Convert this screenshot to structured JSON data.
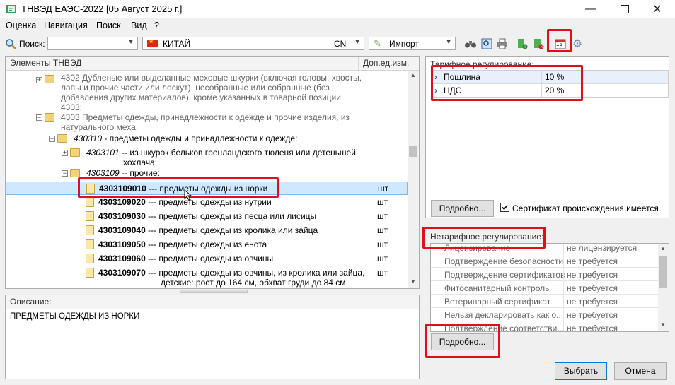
{
  "window": {
    "title": "ТНВЭД ЕАЭС-2022 [05 Август 2025 г.]"
  },
  "menu": [
    "Оценка",
    "Навигация",
    "Поиск",
    "Вид",
    "?"
  ],
  "toolbar": {
    "search_label": "Поиск:",
    "search_value": "",
    "country_name": "КИТАЙ",
    "country_code": "CN",
    "direction": "Импорт",
    "calendar_label": "15"
  },
  "tree": {
    "header": "Элементы ТНВЭД",
    "unit_header": "Доп.ед.изм.",
    "nodes": [
      {
        "lines": [
          "4302 Дубленые или выделанные меховые шкурки (включая головы, хвосты,",
          "лапы и прочие части или лоскут), несобранные или собранные (без",
          "добавления других материалов), кроме указанных в товарной позиции",
          "4303:"
        ]
      },
      {
        "lines": [
          "4303 Предметы одежды, принадлежности к одежде и прочие изделия, из",
          "натурального меха:"
        ]
      },
      {
        "code": "430310",
        "text": " - предметы одежды и принадлежности к одежде:"
      },
      {
        "code": "4303101",
        "text": " -- из шкурок бельков гренландского тюленя или детеньшей",
        "text2": "хохлача:"
      },
      {
        "code": "4303109",
        "text": " -- прочие:"
      }
    ],
    "items": [
      {
        "code": "4303109010",
        "text": " --- предметы одежды из норки",
        "unit": "шт"
      },
      {
        "code": "4303109020",
        "text": " --- предметы одежды из нутрии",
        "unit": "шт"
      },
      {
        "code": "4303109030",
        "text": " --- предметы одежды из песца или лисицы",
        "unit": "шт"
      },
      {
        "code": "4303109040",
        "text": " --- предметы одежды из кролика или зайца",
        "unit": "шт"
      },
      {
        "code": "4303109050",
        "text": " --- предметы одежды из енота",
        "unit": "шт"
      },
      {
        "code": "4303109060",
        "text": " --- предметы одежды из овчины",
        "unit": "шт"
      },
      {
        "code": "4303109070",
        "text": " --- предметы одежды из овчины, из кролика или зайца,",
        "text2": "детские: рост до 164 см, обхват груди до 84 см",
        "unit": "шт"
      }
    ]
  },
  "description": {
    "label": "Описание:",
    "text": "ПРЕДМЕТЫ ОДЕЖДЫ ИЗ НОРКИ"
  },
  "tariff": {
    "header": "Тарифное регулирование:",
    "rows": [
      {
        "name": "Пошлина",
        "value": "10 %"
      },
      {
        "name": "НДС",
        "value": "20 %"
      }
    ],
    "details_button": "Подробно...",
    "certificate_label": "Сертификат происхождения имеется"
  },
  "nontariff": {
    "header": "Нетарифное регулирование:",
    "rows": [
      {
        "name": "Лицензирование",
        "value": "не лицензируется"
      },
      {
        "name": "Подтверждение безопасности",
        "value": "не требуется"
      },
      {
        "name": "Подтверждение сертификатов",
        "value": "не требуется"
      },
      {
        "name": "Фитосанитарный контроль",
        "value": "не требуется"
      },
      {
        "name": "Ветеринарный сертификат",
        "value": "не требуется"
      },
      {
        "name": "Нельзя декларировать как о...",
        "value": "не требуется"
      },
      {
        "name": "Подтверждение соответстви...",
        "value": "не требуется"
      }
    ],
    "details_button": "Подробно..."
  },
  "buttons": {
    "select": "Выбрать",
    "cancel": "Отмена"
  },
  "colors": {
    "highlight": "#e0101a",
    "selection": "#cde8ff",
    "accent": "#0078d7"
  }
}
